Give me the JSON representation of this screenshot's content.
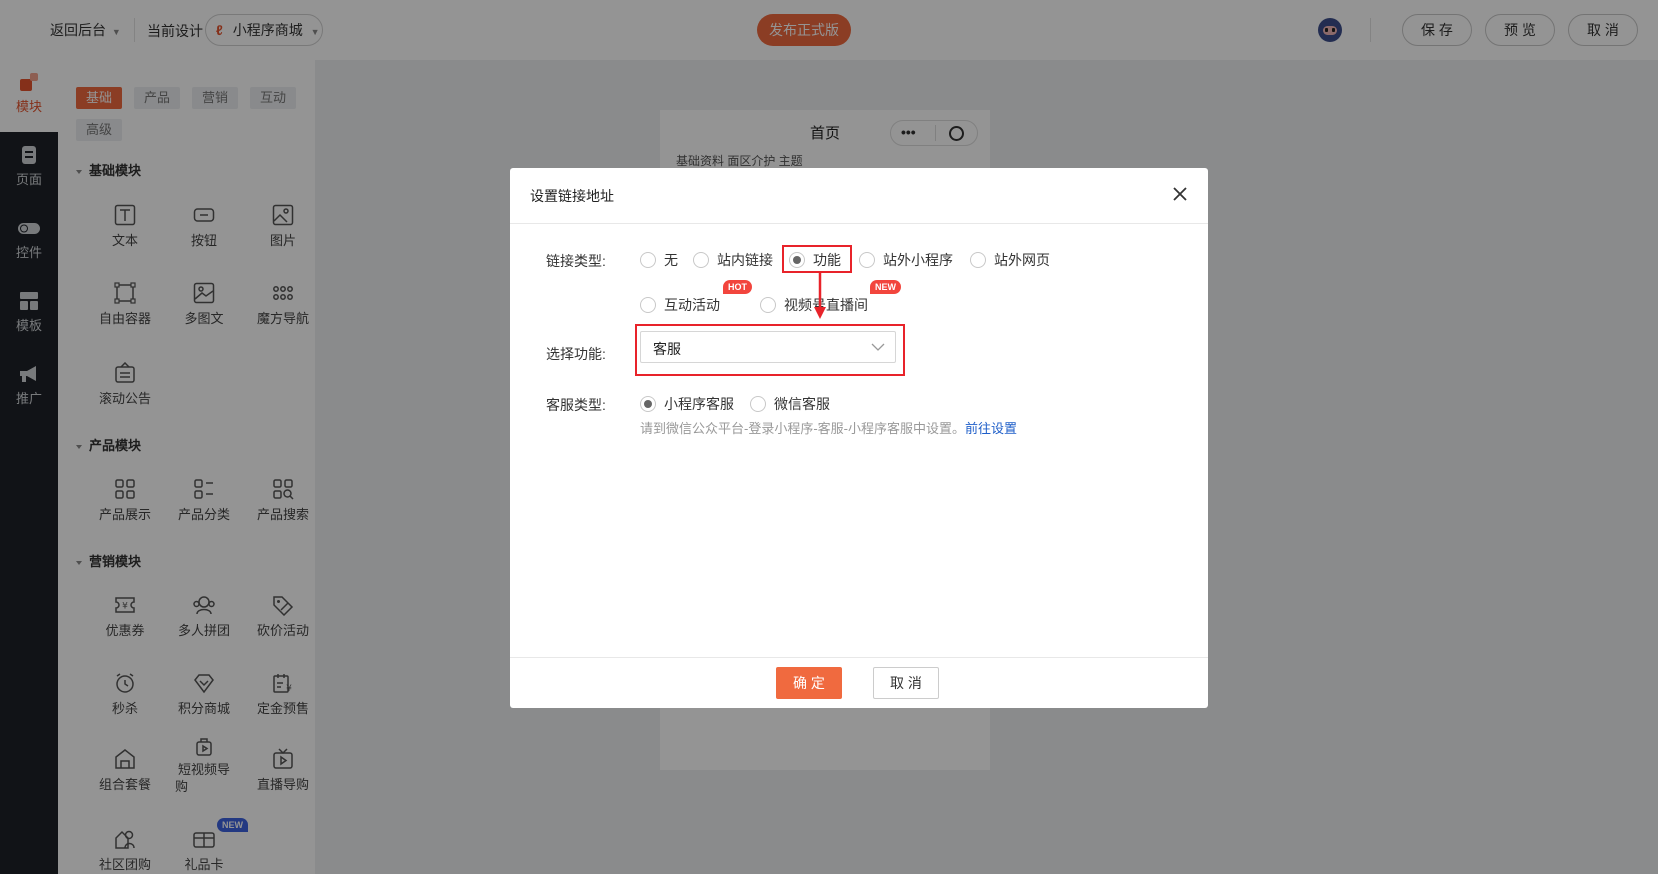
{
  "topbar": {
    "back_label": "返回后台",
    "current_design_label": "当前设计",
    "design_select": "小程序商城",
    "publish_button": "发布正式版",
    "save_button": "保 存",
    "preview_button": "预 览",
    "cancel_button": "取 消"
  },
  "leftnav": {
    "items": [
      {
        "label": "模块",
        "icon": "module-icon"
      },
      {
        "label": "页面",
        "icon": "page-icon"
      },
      {
        "label": "控件",
        "icon": "toggle-icon"
      },
      {
        "label": "模板",
        "icon": "template-icon"
      },
      {
        "label": "推广",
        "icon": "megaphone-icon"
      }
    ]
  },
  "panel": {
    "tabs": [
      "基础",
      "产品",
      "营销",
      "互动",
      "高级"
    ],
    "sections": {
      "basic": "基础模块",
      "product": "产品模块",
      "marketing": "营销模块"
    },
    "modules": {
      "text": "文本",
      "button": "按钮",
      "image": "图片",
      "free_container": "自由容器",
      "multi_image_text": "多图文",
      "magic_nav": "魔方导航",
      "scroll_notice": "滚动公告",
      "product_display": "产品展示",
      "product_category": "产品分类",
      "product_search": "产品搜索",
      "coupon": "优惠券",
      "group_buy": "多人拼团",
      "bargain": "砍价活动",
      "flash_sale": "秒杀",
      "points_mall": "积分商城",
      "deposit_presale": "定金预售",
      "combo": "组合套餐",
      "short_video_line1": "短视频导",
      "short_video_line2": "购",
      "live_guide": "直播导购",
      "community_group": "社区团购",
      "gift_card": "礼品卡",
      "gift_card_badge": "NEW"
    }
  },
  "phone": {
    "title": "首页",
    "subtitle_line": "基础资料  面区介护  主题"
  },
  "dialog": {
    "title": "设置链接地址",
    "link_type_label": "链接类型:",
    "link_types": [
      "无",
      "站内链接",
      "功能",
      "站外小程序",
      "站外网页",
      "互动活动",
      "视频号直播间"
    ],
    "hot_badge": "HOT",
    "new_badge": "NEW",
    "select_function_label": "选择功能:",
    "select_function_value": "客服",
    "service_type_label": "客服类型:",
    "service_types": [
      "小程序客服",
      "微信客服"
    ],
    "hint_text": "请到微信公众平台-登录小程序-客服-小程序客服中设置。",
    "hint_link": "前往设置",
    "confirm_button": "确 定",
    "cancel_button": "取 消"
  },
  "colors": {
    "accent": "#f06a3f",
    "annotation_red": "#e8232a",
    "link_blue": "#1f5fc9",
    "nav_bg": "#1e2228"
  }
}
